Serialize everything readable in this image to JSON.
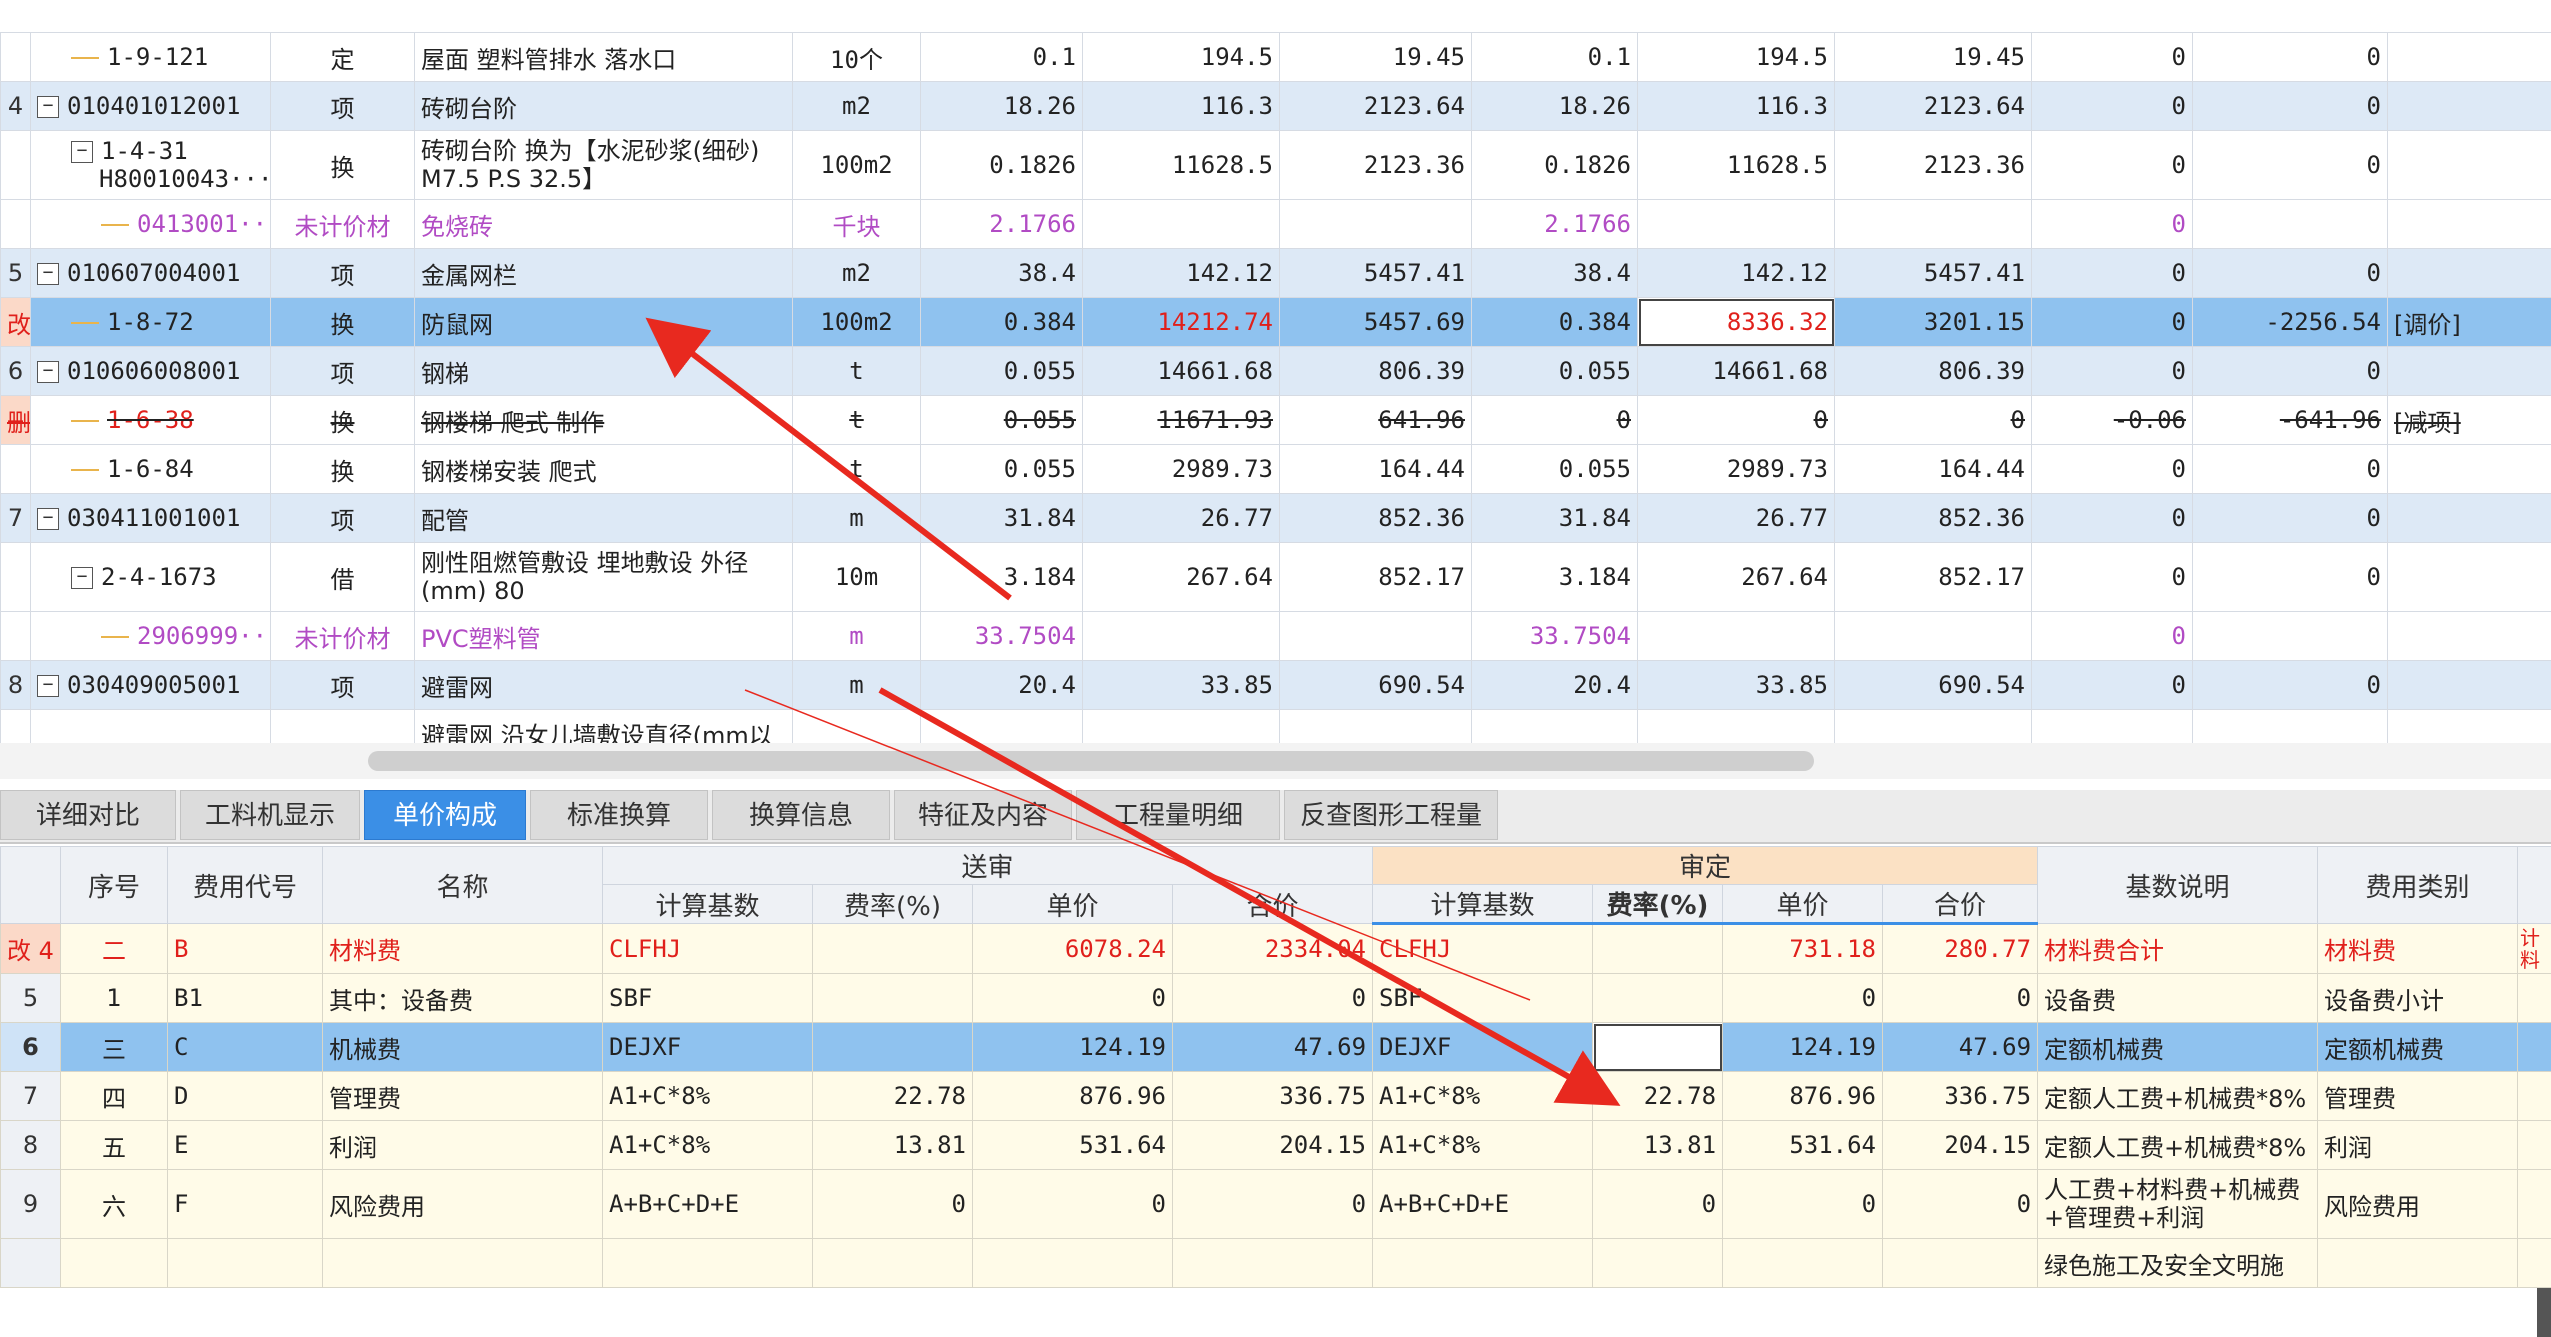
{
  "top_grid": {
    "rows": [
      {
        "no": "",
        "code": "1-9-121",
        "kind": "定",
        "name": "屋面 塑料管排水 落水口",
        "unit": "10个",
        "a1": "0.1",
        "a2": "194.5",
        "a3": "19.45",
        "b1": "0.1",
        "b2": "194.5",
        "b3": "19.45",
        "c1": "0",
        "c2": "0",
        "note": ""
      },
      {
        "no": "4",
        "code": "010401012001",
        "kind": "项",
        "name": "砖砌台阶",
        "unit": "m2",
        "a1": "18.26",
        "a2": "116.3",
        "a3": "2123.64",
        "b1": "18.26",
        "b2": "116.3",
        "b3": "2123.64",
        "c1": "0",
        "c2": "0",
        "note": ""
      },
      {
        "no": "",
        "code": "1-4-31",
        "code2": "H80010043···",
        "kind": "换",
        "name": "砖砌台阶  换为【水泥砂浆(细砂) M7.5 P.S 32.5】",
        "unit": "100m2",
        "a1": "0.1826",
        "a2": "11628.5",
        "a3": "2123.36",
        "b1": "0.1826",
        "b2": "11628.5",
        "b3": "2123.36",
        "c1": "0",
        "c2": "0",
        "note": ""
      },
      {
        "no": "",
        "code": "0413001···",
        "kind": "未计价材",
        "name": "免烧砖",
        "unit": "千块",
        "a1": "2.1766",
        "a2": "",
        "a3": "",
        "b1": "2.1766",
        "b2": "",
        "b3": "",
        "c1": "0",
        "c2": "",
        "note": ""
      },
      {
        "no": "5",
        "code": "010607004001",
        "kind": "项",
        "name": "金属网栏",
        "unit": "m2",
        "a1": "38.4",
        "a2": "142.12",
        "a3": "5457.41",
        "b1": "38.4",
        "b2": "142.12",
        "b3": "5457.41",
        "c1": "0",
        "c2": "0",
        "note": ""
      },
      {
        "no": "改",
        "code": "1-8-72",
        "kind": "换",
        "name": "防鼠网",
        "unit": "100m2",
        "a1": "0.384",
        "a2": "14212.74",
        "a3": "5457.69",
        "b1": "0.384",
        "b2": "8336.32",
        "b3": "3201.15",
        "c1": "0",
        "c2": "-2256.54",
        "note": "[调价]"
      },
      {
        "no": "6",
        "code": "010606008001",
        "kind": "项",
        "name": "钢梯",
        "unit": "t",
        "a1": "0.055",
        "a2": "14661.68",
        "a3": "806.39",
        "b1": "0.055",
        "b2": "14661.68",
        "b3": "806.39",
        "c1": "0",
        "c2": "0",
        "note": ""
      },
      {
        "no": "删",
        "code": "1-6-38",
        "kind": "换",
        "name": "钢楼梯 爬式 制作",
        "unit": "t",
        "a1": "0.055",
        "a2": "11671.93",
        "a3": "641.96",
        "b1": "0",
        "b2": "0",
        "b3": "0",
        "c1": "-0.06",
        "c2": "-641.96",
        "note": "[减项]"
      },
      {
        "no": "",
        "code": "1-6-84",
        "kind": "换",
        "name": "钢楼梯安装 爬式",
        "unit": "t",
        "a1": "0.055",
        "a2": "2989.73",
        "a3": "164.44",
        "b1": "0.055",
        "b2": "2989.73",
        "b3": "164.44",
        "c1": "0",
        "c2": "0",
        "note": ""
      },
      {
        "no": "7",
        "code": "030411001001",
        "kind": "项",
        "name": "配管",
        "unit": "m",
        "a1": "31.84",
        "a2": "26.77",
        "a3": "852.36",
        "b1": "31.84",
        "b2": "26.77",
        "b3": "852.36",
        "c1": "0",
        "c2": "0",
        "note": ""
      },
      {
        "no": "",
        "code": "2-4-1673",
        "kind": "借",
        "name": "刚性阻燃管敷设 埋地敷设 外径(mm) 80",
        "unit": "10m",
        "a1": "3.184",
        "a2": "267.64",
        "a3": "852.17",
        "b1": "3.184",
        "b2": "267.64",
        "b3": "852.17",
        "c1": "0",
        "c2": "0",
        "note": ""
      },
      {
        "no": "",
        "code": "2906999···",
        "kind": "未计价材",
        "name": "PVC塑料管",
        "unit": "m",
        "a1": "33.7504",
        "a2": "",
        "a3": "",
        "b1": "33.7504",
        "b2": "",
        "b3": "",
        "c1": "0",
        "c2": "",
        "note": ""
      },
      {
        "no": "8",
        "code": "030409005001",
        "kind": "项",
        "name": "避雷网",
        "unit": "m",
        "a1": "20.4",
        "a2": "33.85",
        "a3": "690.54",
        "b1": "20.4",
        "b2": "33.85",
        "b3": "690.54",
        "c1": "0",
        "c2": "0",
        "note": ""
      },
      {
        "no": "",
        "code": "",
        "kind": "",
        "name": "避雷网 沿女儿墙敷设直径(mm以",
        "unit": "",
        "a1": "",
        "a2": "",
        "a3": "",
        "b1": "",
        "b2": "",
        "b3": "",
        "c1": "",
        "c2": "",
        "note": ""
      }
    ]
  },
  "tabs": [
    "详细对比",
    "工料机显示",
    "单价构成",
    "标准换算",
    "换算信息",
    "特征及内容",
    "工程量明细",
    "反查图形工程量"
  ],
  "active_tab": "单价构成",
  "bottom_grid": {
    "headers": {
      "seq": "序号",
      "fee_code": "费用代号",
      "name": "名称",
      "submitted": "送审",
      "audited": "审定",
      "base": "计算基数",
      "rate": "费率(%)",
      "price": "单价",
      "total": "合价",
      "base_desc": "基数说明",
      "fee_type": "费用类别"
    },
    "rows": [
      {
        "idx": "改 4",
        "seq": "二",
        "code": "B",
        "name": "材料费",
        "s_base": "CLFHJ",
        "s_rate": "",
        "s_price": "6078.24",
        "s_total": "2334.04",
        "a_base": "CLFHJ",
        "a_rate": "",
        "a_price": "731.18",
        "a_total": "280.77",
        "desc": "材料费合计",
        "type": "材料费",
        "extra": "计\n料"
      },
      {
        "idx": "5",
        "seq": "1",
        "code": "B1",
        "name": "其中：设备费",
        "s_base": "SBF",
        "s_rate": "",
        "s_price": "0",
        "s_total": "0",
        "a_base": "SBF",
        "a_rate": "",
        "a_price": "0",
        "a_total": "0",
        "desc": "设备费",
        "type": "设备费小计",
        "extra": ""
      },
      {
        "idx": "6",
        "seq": "三",
        "code": "C",
        "name": "机械费",
        "s_base": "DEJXF",
        "s_rate": "",
        "s_price": "124.19",
        "s_total": "47.69",
        "a_base": "DEJXF",
        "a_rate": "",
        "a_price": "124.19",
        "a_total": "47.69",
        "desc": "定额机械费",
        "type": "定额机械费",
        "extra": ""
      },
      {
        "idx": "7",
        "seq": "四",
        "code": "D",
        "name": "管理费",
        "s_base": "A1+C*8%",
        "s_rate": "22.78",
        "s_price": "876.96",
        "s_total": "336.75",
        "a_base": "A1+C*8%",
        "a_rate": "22.78",
        "a_price": "876.96",
        "a_total": "336.75",
        "desc": "定额人工费+机械费*8%",
        "type": "管理费",
        "extra": ""
      },
      {
        "idx": "8",
        "seq": "五",
        "code": "E",
        "name": "利润",
        "s_base": "A1+C*8%",
        "s_rate": "13.81",
        "s_price": "531.64",
        "s_total": "204.15",
        "a_base": "A1+C*8%",
        "a_rate": "13.81",
        "a_price": "531.64",
        "a_total": "204.15",
        "desc": "定额人工费+机械费*8%",
        "type": "利润",
        "extra": ""
      },
      {
        "idx": "9",
        "seq": "六",
        "code": "F",
        "name": "风险费用",
        "s_base": "A+B+C+D+E",
        "s_rate": "0",
        "s_price": "0",
        "s_total": "0",
        "a_base": "A+B+C+D+E",
        "a_rate": "0",
        "a_price": "0",
        "a_total": "0",
        "desc": "人工费+材料费+机械费+管理费+利润",
        "type": "风险费用",
        "extra": ""
      },
      {
        "idx": "",
        "seq": "",
        "code": "",
        "name": "",
        "s_base": "",
        "s_rate": "",
        "s_price": "",
        "s_total": "",
        "a_base": "",
        "a_rate": "",
        "a_price": "",
        "a_total": "",
        "desc": "绿色施工及安全文明施",
        "type": "",
        "extra": ""
      }
    ]
  },
  "colors": {
    "selected": "#8fc2ef",
    "bill_row": "#dde9f6",
    "arrow": "#e8291f",
    "active_tab": "#3b8fe6",
    "audit_header": "#fbe1c4"
  }
}
